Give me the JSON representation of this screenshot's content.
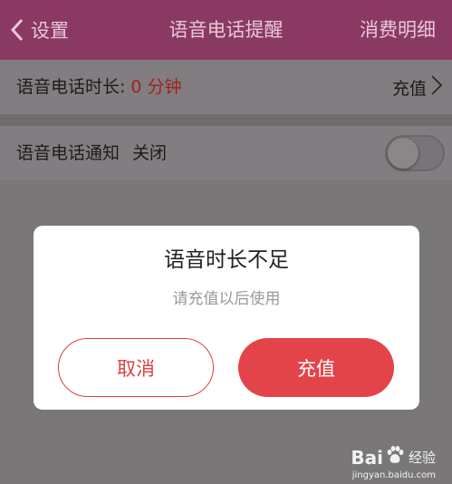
{
  "navbar": {
    "back_label": "设置",
    "title": "语音电话提醒",
    "right_label": "消费明细"
  },
  "duration_row": {
    "label": "语音电话时长:",
    "value": "0 分钟",
    "action_label": "充值"
  },
  "notify_row": {
    "label": "语音电话通知",
    "state": "关闭",
    "toggle_on": false
  },
  "dialog": {
    "title": "语音时长不足",
    "message": "请充值以后使用",
    "cancel_label": "取消",
    "confirm_label": "充值"
  },
  "watermark": {
    "brand_left": "Bai",
    "brand_right": "经验",
    "url": "jingyan.baidu.com"
  },
  "colors": {
    "navbar": "#8a3a62",
    "accent_red": "#e24449",
    "value_red": "#a3221c"
  },
  "icons": [
    "chevron-left-icon",
    "chevron-right-icon",
    "baidu-paw-icon"
  ]
}
